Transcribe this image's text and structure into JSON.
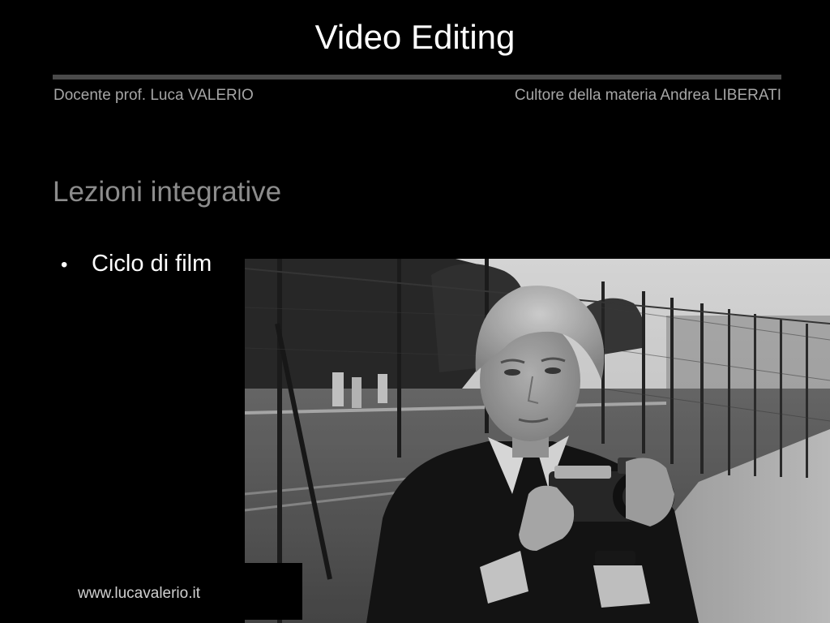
{
  "slide": {
    "title": "Video Editing",
    "header_left": "Docente prof. Luca VALERIO",
    "header_right": "Cultore della materia Andrea LIBERATI",
    "section_title": "Lezioni integrative",
    "bullets": [
      {
        "marker": "•",
        "text": "Ciclo di film"
      }
    ],
    "footer_link": "www.lucavalerio.it",
    "photo": {
      "subject": "black-and-white film still: young man holding a camera",
      "colors": {
        "sky": "#d9d9d9",
        "trees": "#2e2e2e",
        "ground": "#5e5e5e",
        "path": "#b5b5b5",
        "jacket": "#161616",
        "skin": "#a9a9a9",
        "hair": "#c8c8c8"
      }
    }
  },
  "colors": {
    "background": "#000000",
    "title_text": "#ffffff",
    "rule": "#4a4a4a",
    "header_text": "#a6a6a6",
    "section_text": "#8c8c8c"
  }
}
